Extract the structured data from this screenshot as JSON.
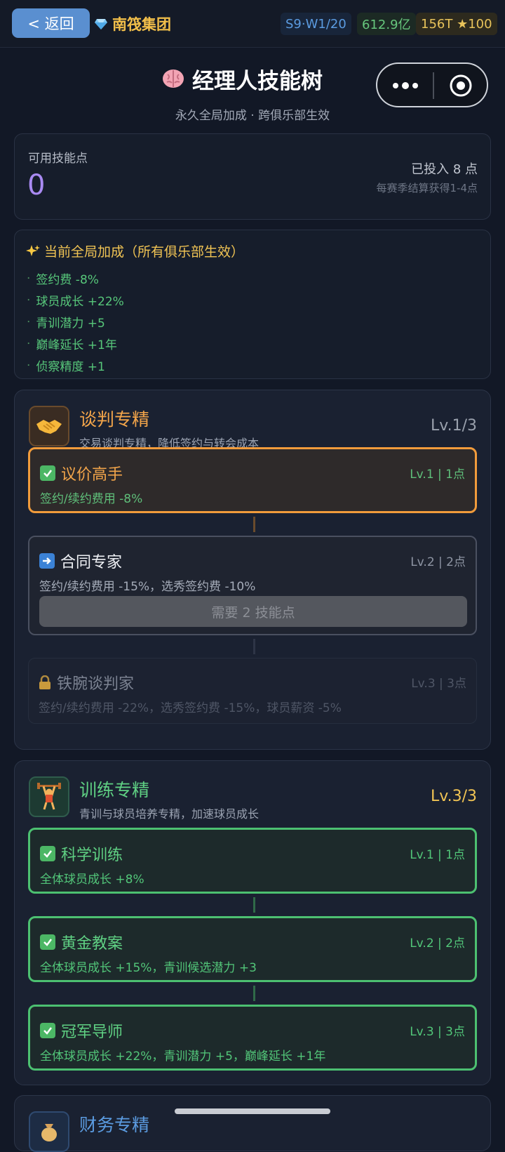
{
  "topbar": {
    "back_label": "< 返回",
    "group_name": "南筏集团",
    "season": "S9·W1/20",
    "money": "612.9亿",
    "rating": "156T ★100"
  },
  "header": {
    "title": "经理人技能树",
    "subtitle": "永久全局加成 · 跨俱乐部生效"
  },
  "points": {
    "label": "可用技能点",
    "value": "0",
    "invested": "已投入 8 点",
    "season_gain": "每赛季结算获得1-4点"
  },
  "bonus": {
    "title": "当前全局加成（所有俱乐部生效）",
    "items": [
      "签约费 -8%",
      "球员成长 +22%",
      "青训潜力 +5",
      "巅峰延长 +1年",
      "侦察精度 +1"
    ]
  },
  "branches": [
    {
      "icon": "handshake-icon",
      "name": "谈判专精",
      "desc": "交易谈判专精，降低签约与转会成本",
      "level": "Lv.1/3",
      "color": "#f19b3b",
      "nodes": [
        {
          "state": "done",
          "name": "议价高手",
          "lv": "Lv.1 | 1点",
          "effect": "签约/续约费用 -8%"
        },
        {
          "state": "next",
          "name": "合同专家",
          "lv": "Lv.2 | 2点",
          "effect": "签约/续约费用 -15%，选秀签约费 -10%",
          "need": "需要 2 技能点"
        },
        {
          "state": "locked",
          "name": "铁腕谈判家",
          "lv": "Lv.3 | 3点",
          "effect": "签约/续约费用 -22%，选秀签约费 -15%，球员薪资 -5%"
        }
      ]
    },
    {
      "icon": "weightlifter-icon",
      "name": "训练专精",
      "desc": "青训与球员培养专精，加速球员成长",
      "level": "Lv.3/3",
      "color": "#4cc071",
      "nodes": [
        {
          "state": "done",
          "name": "科学训练",
          "lv": "Lv.1 | 1点",
          "effect": "全体球员成长 +8%"
        },
        {
          "state": "done",
          "name": "黄金教案",
          "lv": "Lv.2 | 2点",
          "effect": "全体球员成长 +15%，青训候选潜力 +3"
        },
        {
          "state": "done",
          "name": "冠军导师",
          "lv": "Lv.3 | 3点",
          "effect": "全体球员成长 +22%，青训潜力 +5，巅峰延长 +1年"
        }
      ]
    },
    {
      "icon": "finance-icon",
      "name": "财务专精"
    }
  ]
}
